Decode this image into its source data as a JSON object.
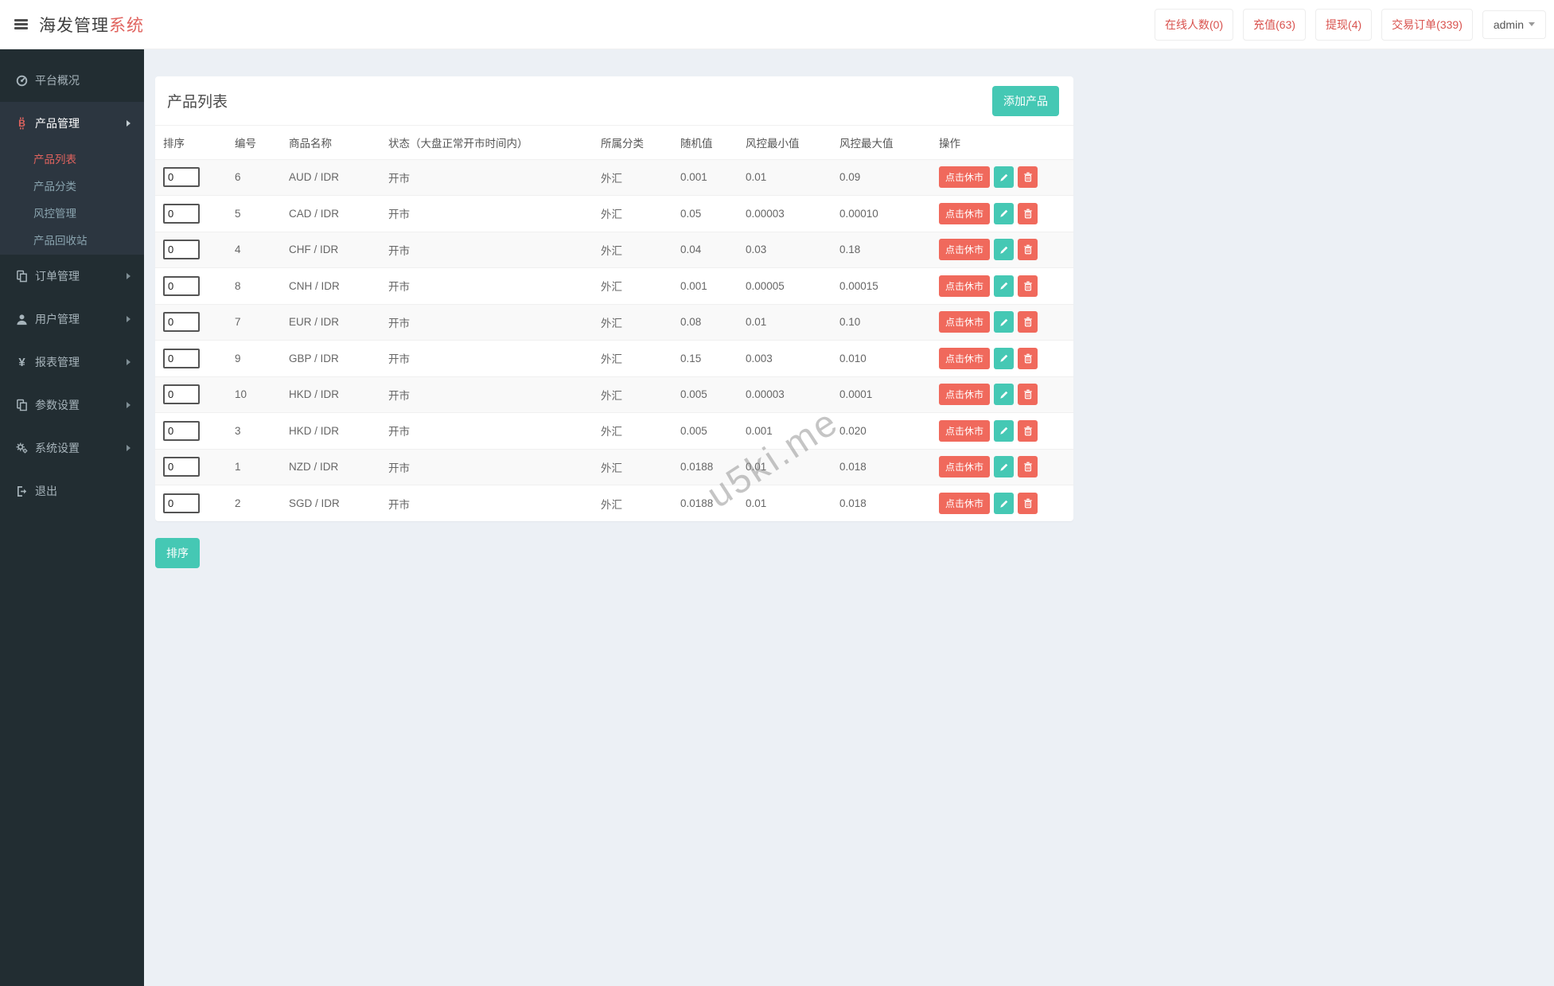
{
  "header": {
    "logo_prefix": "海发管理",
    "logo_suffix": "系统",
    "stats": [
      {
        "label": "在线人数(0)"
      },
      {
        "label": "充值(63)"
      },
      {
        "label": "提现(4)"
      },
      {
        "label": "交易订单(339)"
      }
    ],
    "user": {
      "name": "admin"
    }
  },
  "sidebar": {
    "items": [
      {
        "label": "平台概况",
        "icon": "gauge-icon"
      },
      {
        "label": "产品管理",
        "icon": "bitcoin-icon",
        "expanded": true,
        "children": [
          {
            "label": "产品列表",
            "active": true
          },
          {
            "label": "产品分类"
          },
          {
            "label": "风控管理"
          },
          {
            "label": "产品回收站"
          }
        ]
      },
      {
        "label": "订单管理",
        "icon": "files-icon"
      },
      {
        "label": "用户管理",
        "icon": "user-icon"
      },
      {
        "label": "报表管理",
        "icon": "yen-icon"
      },
      {
        "label": "参数设置",
        "icon": "files-icon"
      },
      {
        "label": "系统设置",
        "icon": "gears-icon"
      },
      {
        "label": "退出",
        "icon": "signout-icon"
      }
    ]
  },
  "main": {
    "card_title": "产品列表",
    "add_button": "添加产品",
    "sort_button": "排序",
    "watermark": "u5ki.me",
    "table": {
      "headers": [
        "排序",
        "编号",
        "商品名称",
        "状态（大盘正常开市时间内）",
        "所属分类",
        "随机值",
        "风控最小值",
        "风控最大值",
        "操作"
      ],
      "close_market_label": "点击休市",
      "rows": [
        {
          "sort": "0",
          "id": "6",
          "name": "AUD / IDR",
          "status": "开市",
          "category": "外汇",
          "random": "0.001",
          "risk_min": "0.01",
          "risk_max": "0.09"
        },
        {
          "sort": "0",
          "id": "5",
          "name": "CAD / IDR",
          "status": "开市",
          "category": "外汇",
          "random": "0.05",
          "risk_min": "0.00003",
          "risk_max": "0.00010"
        },
        {
          "sort": "0",
          "id": "4",
          "name": "CHF / IDR",
          "status": "开市",
          "category": "外汇",
          "random": "0.04",
          "risk_min": "0.03",
          "risk_max": "0.18"
        },
        {
          "sort": "0",
          "id": "8",
          "name": "CNH / IDR",
          "status": "开市",
          "category": "外汇",
          "random": "0.001",
          "risk_min": "0.00005",
          "risk_max": "0.00015"
        },
        {
          "sort": "0",
          "id": "7",
          "name": "EUR / IDR",
          "status": "开市",
          "category": "外汇",
          "random": "0.08",
          "risk_min": "0.01",
          "risk_max": "0.10"
        },
        {
          "sort": "0",
          "id": "9",
          "name": "GBP / IDR",
          "status": "开市",
          "category": "外汇",
          "random": "0.15",
          "risk_min": "0.003",
          "risk_max": "0.010"
        },
        {
          "sort": "0",
          "id": "10",
          "name": "HKD / IDR",
          "status": "开市",
          "category": "外汇",
          "random": "0.005",
          "risk_min": "0.00003",
          "risk_max": "0.0001"
        },
        {
          "sort": "0",
          "id": "3",
          "name": "HKD / IDR",
          "status": "开市",
          "category": "外汇",
          "random": "0.005",
          "risk_min": "0.001",
          "risk_max": "0.020"
        },
        {
          "sort": "0",
          "id": "1",
          "name": "NZD / IDR",
          "status": "开市",
          "category": "外汇",
          "random": "0.0188",
          "risk_min": "0.01",
          "risk_max": "0.018"
        },
        {
          "sort": "0",
          "id": "2",
          "name": "SGD / IDR",
          "status": "开市",
          "category": "外汇",
          "random": "0.0188",
          "risk_min": "0.01",
          "risk_max": "0.018"
        }
      ]
    }
  },
  "colors": {
    "accent_teal": "#45c8b4",
    "accent_red": "#f0695c",
    "header_red": "#d9534f",
    "sidebar_bg": "#222d32",
    "sidebar_open_bg": "#2c3640",
    "active_link_red": "#e0635e",
    "content_bg": "#ecf0f5"
  }
}
